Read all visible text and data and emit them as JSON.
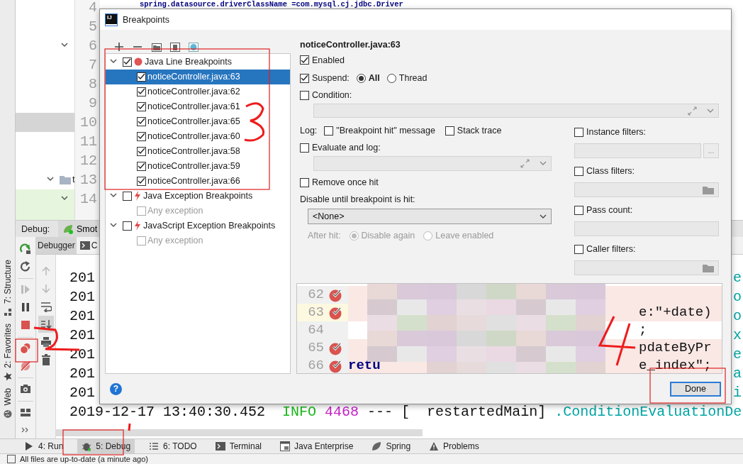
{
  "editor": {
    "line_numbers": [
      "4",
      "5",
      "6",
      "7",
      "8",
      "9",
      "10",
      "11",
      "12",
      "13",
      "14"
    ],
    "code_line": "spring.datasource.driverClassName =com.mysql.cj.jdbc.Driver"
  },
  "project_tree": {
    "rows": [
      {
        "kind": "plain"
      },
      {
        "kind": "plain"
      },
      {
        "kind": "expander"
      },
      {
        "kind": "plain"
      },
      {
        "kind": "plain"
      },
      {
        "kind": "plain"
      },
      {
        "kind": "selected"
      },
      {
        "kind": "plain"
      },
      {
        "kind": "plain"
      },
      {
        "kind": "folder",
        "label": "t"
      },
      {
        "kind": "changed"
      }
    ]
  },
  "side_stripe": [
    {
      "label": "7: Structure",
      "kind": "structure"
    },
    {
      "label": "2: Favorites",
      "kind": "favorites"
    },
    {
      "label": "Web",
      "kind": "web"
    }
  ],
  "debug": {
    "title": "Debug:",
    "session": "Smot",
    "tabs": [
      {
        "label": "Debugger",
        "kind": "debugger",
        "selected": true
      },
      {
        "label": "C",
        "kind": "console",
        "selected": false
      }
    ],
    "console_tools": [
      {
        "kind": "up",
        "selected": false
      },
      {
        "kind": "down",
        "selected": false
      },
      {
        "kind": "wrap",
        "selected": false
      },
      {
        "kind": "scroll-end",
        "selected": true
      },
      {
        "kind": "print",
        "selected": false
      },
      {
        "kind": "trash",
        "selected": false
      }
    ]
  },
  "console": {
    "lines": [
      {
        "text": "201",
        "edge": "e"
      },
      {
        "text": "201",
        "edge": "o"
      },
      {
        "text": "201",
        "edge": "o"
      },
      {
        "text": "201",
        "edge": "x"
      },
      {
        "text": "201",
        "edge": "e"
      },
      {
        "text": "201",
        "edge": "a"
      },
      {
        "text": "201",
        "edge": "i"
      }
    ],
    "last_line": [
      {
        "kind": "plain",
        "text": "2019-12-17 13:40:30.452  "
      },
      {
        "kind": "level",
        "text": "INFO"
      },
      {
        "kind": "pid",
        "text": " 4468"
      },
      {
        "kind": "plain",
        "text": " --- [  restartedMain] "
      },
      {
        "kind": "logger",
        "text": ".ConditionEvaluationDe"
      }
    ]
  },
  "bottom_tabs": [
    {
      "label": "4: Run",
      "kind": "run",
      "selected": false
    },
    {
      "label": "5: Debug",
      "kind": "debug",
      "selected": true
    },
    {
      "label": "6: TODO",
      "kind": "todo",
      "selected": false
    },
    {
      "label": "Terminal",
      "kind": "terminal",
      "selected": false
    },
    {
      "label": "Java Enterprise",
      "kind": "enterprise",
      "selected": false
    },
    {
      "label": "Spring",
      "kind": "spring",
      "selected": false
    },
    {
      "label": "Problems",
      "kind": "problems",
      "selected": false
    }
  ],
  "status_bar": {
    "text": "All files are up-to-date (a minute ago)"
  },
  "dialog": {
    "title": "Breakpoints",
    "logo": "IJ",
    "tree": [
      {
        "label": "Java Line Breakpoints",
        "kind": "line",
        "checked": true,
        "expanded": true,
        "selected": false,
        "children": [
          {
            "label": "noticeController.java:63",
            "checked": true,
            "selected": true,
            "disabled": false
          },
          {
            "label": "noticeController.java:62",
            "checked": true,
            "selected": false,
            "disabled": false
          },
          {
            "label": "noticeController.java:61",
            "checked": true,
            "selected": false,
            "disabled": false
          },
          {
            "label": "noticeController.java:65",
            "checked": true,
            "selected": false,
            "disabled": false
          },
          {
            "label": "noticeController.java:60",
            "checked": true,
            "selected": false,
            "disabled": false
          },
          {
            "label": "noticeController.java:58",
            "checked": true,
            "selected": false,
            "disabled": false
          },
          {
            "label": "noticeController.java:59",
            "checked": true,
            "selected": false,
            "disabled": false
          },
          {
            "label": "noticeController.java:66",
            "checked": true,
            "selected": false,
            "disabled": false
          }
        ]
      },
      {
        "label": "Java Exception Breakpoints",
        "kind": "exception",
        "checked": false,
        "expanded": true,
        "selected": false,
        "children": [
          {
            "label": "Any exception",
            "checked": false,
            "selected": false,
            "disabled": true
          }
        ]
      },
      {
        "label": "JavaScript Exception Breakpoints",
        "kind": "exception",
        "checked": false,
        "expanded": true,
        "selected": false,
        "children": [
          {
            "label": "Any exception",
            "checked": false,
            "selected": false,
            "disabled": true
          }
        ]
      }
    ],
    "details": {
      "heading": "noticeController.java:63",
      "enabled": {
        "label": "Enabled",
        "checked": true
      },
      "suspend": {
        "label": "Suspend:",
        "checked": true,
        "options": [
          {
            "label": "All",
            "selected": true
          },
          {
            "label": "Thread",
            "selected": false
          }
        ]
      },
      "condition": {
        "label": "Condition:",
        "checked": false
      },
      "log": {
        "label": "Log:",
        "options": [
          {
            "label": "\"Breakpoint hit\" message",
            "checked": false
          },
          {
            "label": "Stack trace",
            "checked": false
          }
        ]
      },
      "evaluate": {
        "label": "Evaluate and log:",
        "checked": false
      },
      "remove_once_hit": {
        "label": "Remove once hit",
        "checked": false
      },
      "disable_until": {
        "label": "Disable until breakpoint is hit:",
        "value": "<None>"
      },
      "after_hit": {
        "label": "After hit:",
        "options": [
          {
            "label": "Disable again",
            "selected": true
          },
          {
            "label": "Leave enabled",
            "selected": false
          }
        ]
      },
      "filters": [
        {
          "label": "Instance filters:",
          "checked": false,
          "kind": "more",
          "button": "..."
        },
        {
          "label": "Class filters:",
          "checked": false,
          "kind": "browse"
        },
        {
          "label": "Pass count:",
          "checked": false,
          "kind": "plain"
        },
        {
          "label": "Caller filters:",
          "checked": false,
          "kind": "browse"
        }
      ]
    },
    "preview": [
      {
        "number": "62",
        "breakpoint": true,
        "current": false
      },
      {
        "number": "63",
        "breakpoint": true,
        "current": true,
        "right": "e:\"+date)"
      },
      {
        "number": "64",
        "breakpoint": false,
        "current": false,
        "right": ";"
      },
      {
        "number": "65",
        "breakpoint": true,
        "current": false,
        "right": "pdateByPr"
      },
      {
        "number": "66",
        "breakpoint": true,
        "current": false,
        "left": "retu",
        "right": "e_index\";"
      }
    ],
    "help": "?",
    "done": "Done"
  }
}
